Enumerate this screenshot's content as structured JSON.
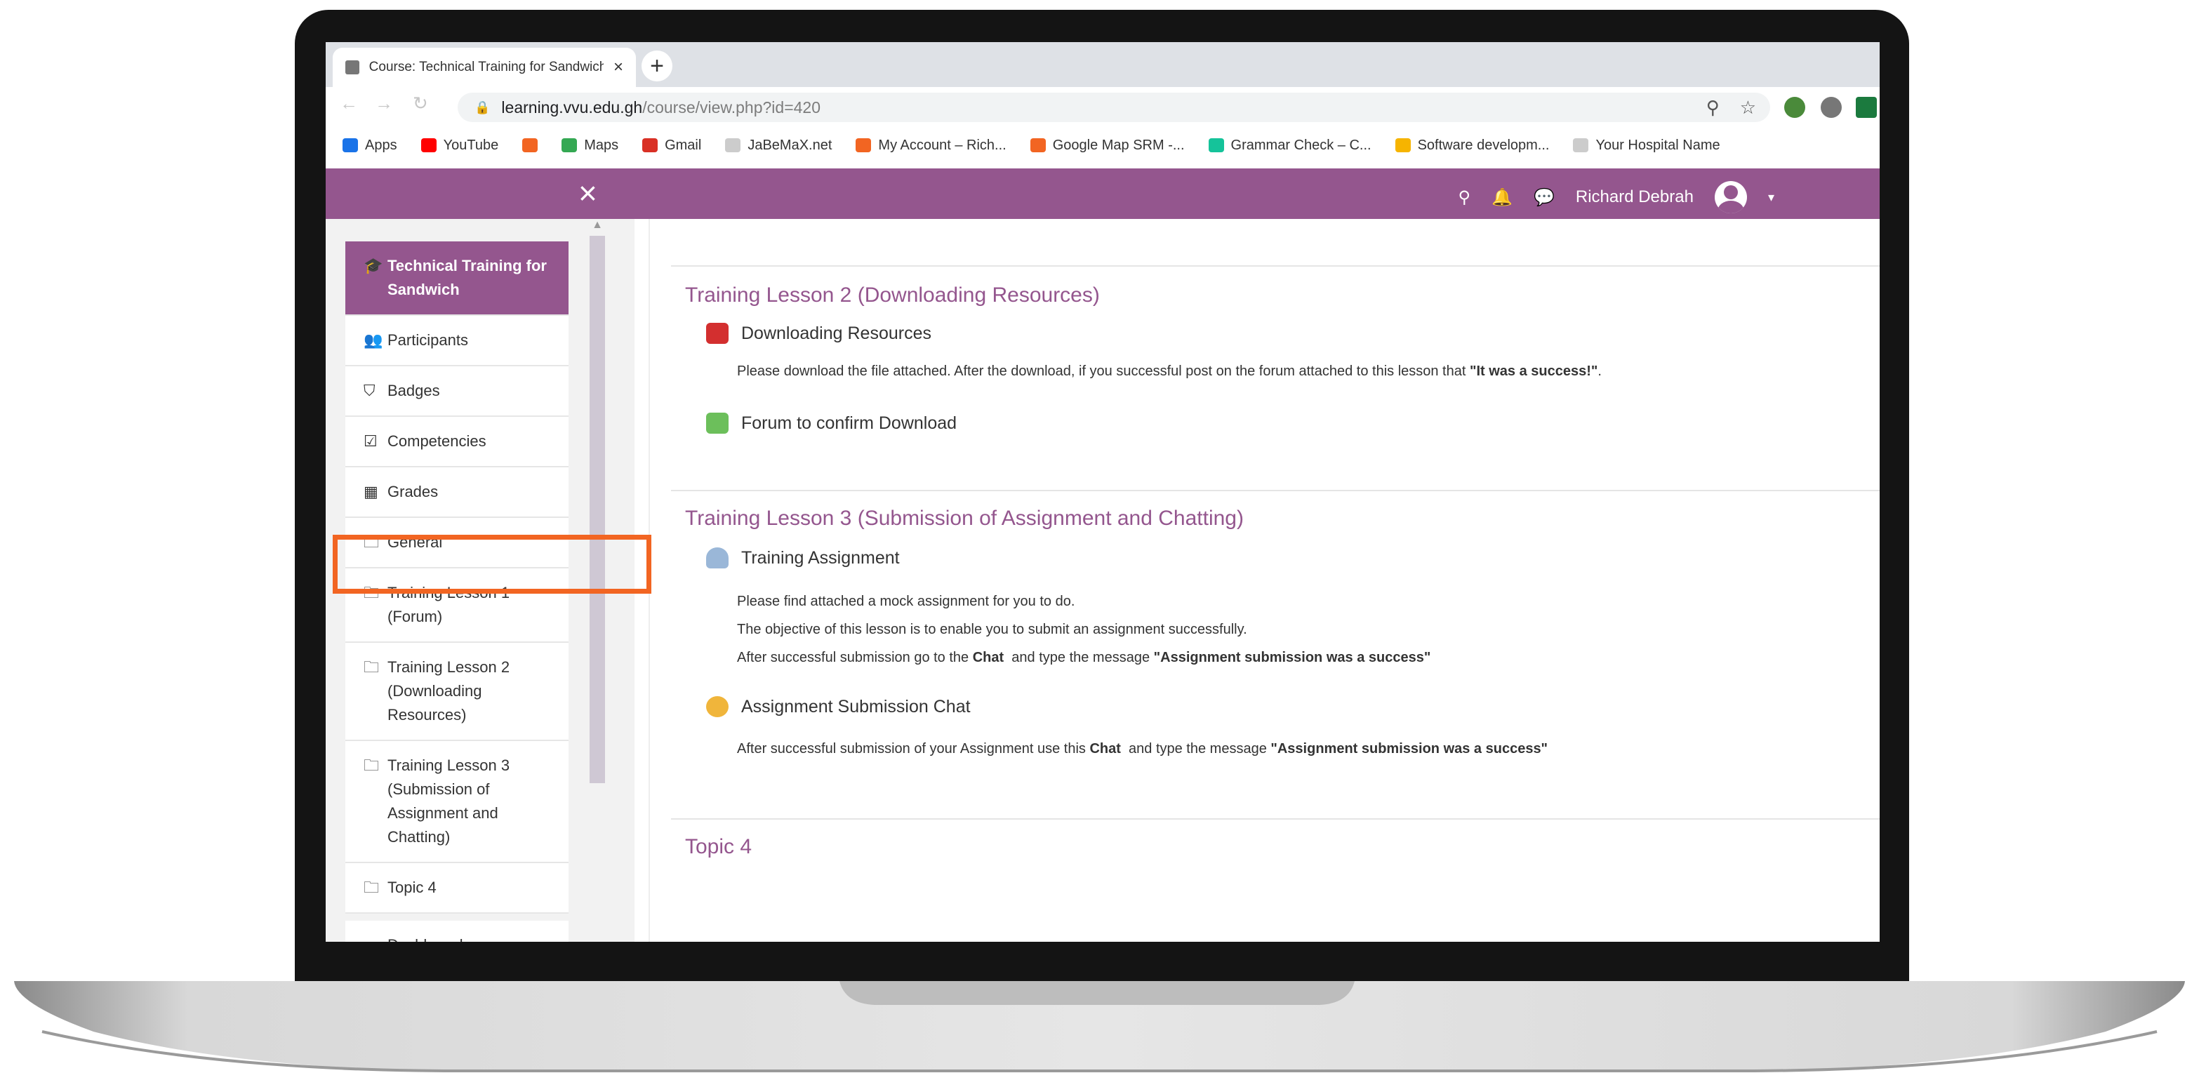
{
  "browser": {
    "tab_title": "Course: Technical Training for Sandwich",
    "tab_close": "×",
    "new_tab": "+",
    "url_host": "learning.vvu.edu.gh",
    "url_path": "/course/view.php?id=420",
    "bookmarks": [
      {
        "label": "Apps",
        "icon": "apps-grid-icon",
        "color": "#1a73e8"
      },
      {
        "label": "YouTube",
        "icon": "youtube-icon",
        "color": "#ff0000"
      },
      {
        "label": "",
        "icon": "bookmark-icon",
        "color": "#f26522"
      },
      {
        "label": "Maps",
        "icon": "maps-icon",
        "color": "#34a853"
      },
      {
        "label": "Gmail",
        "icon": "gmail-icon",
        "color": "#d93025"
      },
      {
        "label": "JaBeMaX.net",
        "icon": "globe-icon",
        "color": "#cccccc"
      },
      {
        "label": "My Account – Rich...",
        "icon": "bookmark-icon",
        "color": "#f26522"
      },
      {
        "label": "Google Map SRM -...",
        "icon": "bookmark-icon",
        "color": "#f26522"
      },
      {
        "label": "Grammar Check – C...",
        "icon": "grammarly-icon",
        "color": "#15c39a"
      },
      {
        "label": "Software developm...",
        "icon": "software-icon",
        "color": "#f6b400"
      },
      {
        "label": "Your Hospital Name",
        "icon": "globe-icon",
        "color": "#cccccc"
      }
    ]
  },
  "navbar": {
    "close_icon": "×",
    "user_name": "Richard Debrah",
    "brand_color": "#94568e"
  },
  "drawer": {
    "items": [
      {
        "label": "Technical Training for Sandwich",
        "icon": "graduation-cap-icon",
        "glyph": "🎓",
        "active": true
      },
      {
        "label": "Participants",
        "icon": "users-icon",
        "glyph": "👥"
      },
      {
        "label": "Badges",
        "icon": "shield-icon",
        "glyph": "⛉"
      },
      {
        "label": "Competencies",
        "icon": "checkbox-icon",
        "glyph": "☑"
      },
      {
        "label": "Grades",
        "icon": "table-icon",
        "glyph": "▦"
      },
      {
        "label": "General",
        "icon": "folder-icon",
        "glyph": "🗀"
      },
      {
        "label": "Training Lesson 1 (Forum)",
        "icon": "folder-icon",
        "glyph": "🗀"
      },
      {
        "label": "Training Lesson 2 (Downloading Resources)",
        "icon": "folder-icon",
        "glyph": "🗀"
      },
      {
        "label": "Training Lesson 3 (Submission of Assignment and Chatting)",
        "icon": "folder-icon",
        "glyph": "🗀"
      },
      {
        "label": "Topic 4",
        "icon": "folder-icon",
        "glyph": "🗀"
      }
    ],
    "dashboard": {
      "label": "Dashboard",
      "icon": "dashboard-icon",
      "glyph": "◕"
    }
  },
  "content": {
    "lesson2": {
      "title": "Training Lesson 2 (Downloading Resources)",
      "resource": "Downloading Resources",
      "resource_desc_pre": "Please download the file attached. After the download, if you successful post on the forum attached to this lesson that ",
      "resource_desc_bold": "\"It was a success!\"",
      "resource_desc_post": ".",
      "forum": "Forum to confirm Download"
    },
    "lesson3": {
      "title": "Training Lesson 3 (Submission of Assignment and Chatting)",
      "assignment": "Training Assignment",
      "desc1": "Please find attached a mock assignment for you to do.",
      "desc2": "The objective of this lesson is to enable you to submit an assignment successfully.",
      "desc3_pre": "After successful submission go to the ",
      "desc3_chat": "Chat",
      "desc3_mid": "  and type the message ",
      "desc3_bold": "\"Assignment submission was a success\"",
      "chat": "Assignment Submission Chat",
      "chat_desc_pre": "After successful submission of your Assignment use this ",
      "chat_desc_chat": "Chat",
      "chat_desc_mid": "  and type the message ",
      "chat_desc_bold": "\"Assignment submission was a success\""
    },
    "topic4": {
      "title": "Topic 4"
    },
    "highlight_color": "#f26522"
  }
}
